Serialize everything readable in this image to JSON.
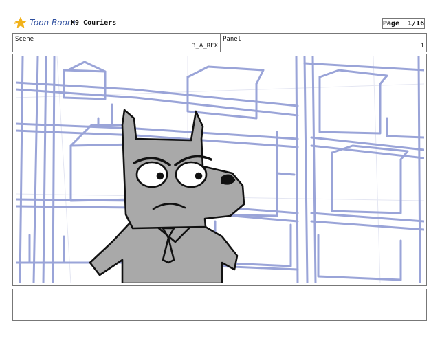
{
  "header": {
    "logo_text": "Toon Boom",
    "project_title": "K9 Couriers",
    "page_label": "Page",
    "page_number": "1/16"
  },
  "info": {
    "scene_label": "Scene",
    "scene_value": "3_A_REX",
    "panel_label": "Panel",
    "panel_value": "1"
  },
  "frame": {
    "icon": "storyboard-drawing",
    "background_color": "#9aa4d8",
    "character_color": "#a9a9a9"
  },
  "notes": {
    "text": ""
  }
}
